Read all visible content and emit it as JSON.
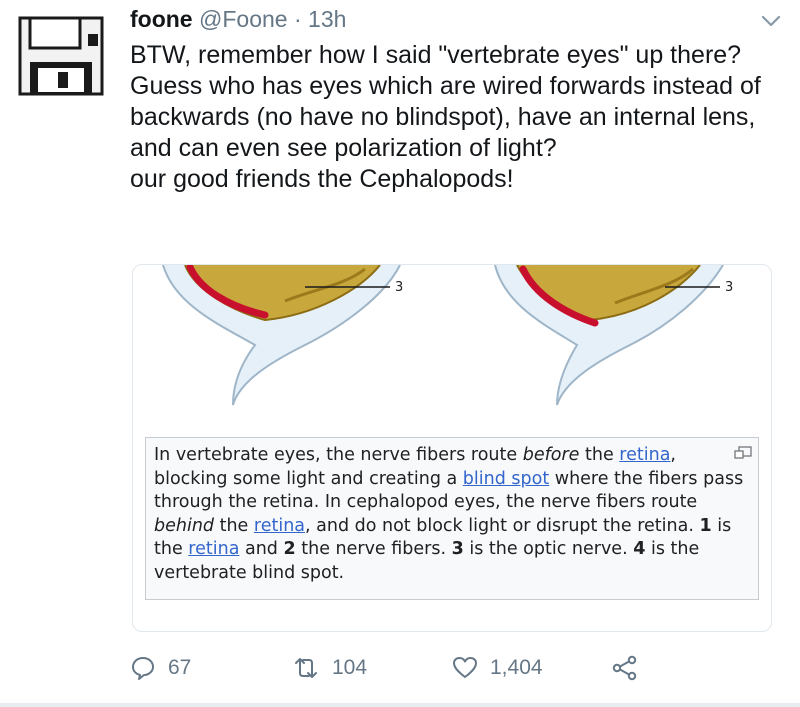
{
  "tweet": {
    "author_name": "foone",
    "handle": "@Foone",
    "separator": "·",
    "time": "13h",
    "lines": [
      "BTW, remember how I said \"vertebrate eyes\" up there?",
      "Guess who has eyes which are wired forwards instead of backwards (no have no blindspot), have an internal lens, and can even see polarization of light?",
      "our good friends the Cephalopods!"
    ]
  },
  "card": {
    "figure_labels": [
      "3",
      "3"
    ],
    "caption": {
      "t1": "In vertebrate eyes, the nerve fibers route ",
      "em1": "before",
      "t2": " the ",
      "link1": "retina",
      "t3": ", blocking some light and creating a ",
      "link2": "blind spot",
      "t4": " where the fibers pass through the retina. In cephalopod eyes, the nerve fibers route ",
      "em2": "behind",
      "t5": " the ",
      "link3": "retina",
      "t6": ", and do not block light or disrupt the retina. ",
      "b1": "1",
      "t7": " is the ",
      "link4": "retina",
      "t8": " and ",
      "b2": "2",
      "t9": " the nerve fibers. ",
      "b3": "3",
      "t10": " is the optic nerve. ",
      "b4": "4",
      "t11": " is the vertebrate blind spot."
    }
  },
  "actions": {
    "reply_count": "67",
    "retweet_count": "104",
    "like_count": "1,404"
  },
  "icons": {
    "avatar": "floppy-disk-icon",
    "menu": "chevron-down-icon",
    "reply": "reply-icon",
    "retweet": "retweet-icon",
    "like": "heart-icon",
    "share": "share-icon",
    "enlarge": "magnify-icon"
  },
  "colors": {
    "link": "#3366cc",
    "muted": "#657786",
    "retina": "#c8102e",
    "nerve": "#c8a83c"
  }
}
